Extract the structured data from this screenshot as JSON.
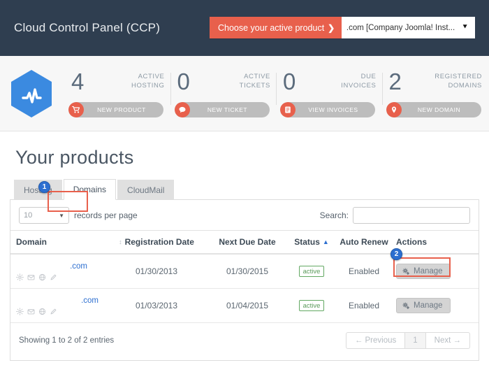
{
  "header": {
    "brand": "Cloud Control Panel (CCP)",
    "picker_label": "Choose your active product",
    "picker_chevron": "❯",
    "picker_value": ".com [Company Joomla! Inst...",
    "picker_caret": "⯆",
    "accent_color": "#e8604c",
    "bar_color": "#2f3e50"
  },
  "stats": {
    "logo_icon": "pulse-hexagon-logo",
    "items": [
      {
        "number": "4",
        "label_line1": "ACTIVE",
        "label_line2": "HOSTING",
        "button": "NEW PRODUCT",
        "icon": "shopping-cart-icon"
      },
      {
        "number": "0",
        "label_line1": "ACTIVE",
        "label_line2": "TICKETS",
        "button": "NEW TICKET",
        "icon": "speech-bubble-icon"
      },
      {
        "number": "0",
        "label_line1": "DUE",
        "label_line2": "INVOICES",
        "button": "VIEW INVOICES",
        "icon": "invoice-list-icon"
      },
      {
        "number": "2",
        "label_line1": "REGISTERED",
        "label_line2": "DOMAINS",
        "button": "NEW DOMAIN",
        "icon": "globe-shield-icon"
      }
    ]
  },
  "page": {
    "title": "Your products"
  },
  "tabs": [
    {
      "label": "Hosting",
      "active": false
    },
    {
      "label": "Domains",
      "active": true
    },
    {
      "label": "CloudMail",
      "active": false
    }
  ],
  "annotations": [
    {
      "number": "1",
      "target": "domains-tab"
    },
    {
      "number": "2",
      "target": "manage-button-row-1"
    }
  ],
  "controls": {
    "records_per_page_value": "10",
    "records_per_page_label": "records per page",
    "search_label": "Search:",
    "search_value": "",
    "search_placeholder": ""
  },
  "table": {
    "columns": [
      {
        "label": "Domain",
        "sort": "none"
      },
      {
        "label": "Registration Date",
        "sort": "both"
      },
      {
        "label": "Next Due Date",
        "sort": "none"
      },
      {
        "label": "Status",
        "sort": "asc"
      },
      {
        "label": "Auto Renew",
        "sort": "none"
      },
      {
        "label": "Actions",
        "sort": "none"
      }
    ],
    "rows": [
      {
        "domain": ".com",
        "registration_date": "01/30/2013",
        "next_due_date": "01/30/2015",
        "status": "active",
        "auto_renew": "Enabled",
        "action": "Manage"
      },
      {
        "domain": ".com",
        "registration_date": "01/03/2013",
        "next_due_date": "01/04/2015",
        "status": "active",
        "auto_renew": "Enabled",
        "action": "Manage"
      }
    ],
    "row_icons": [
      "gear-icon",
      "envelope-icon",
      "globe-icon",
      "pencil-icon"
    ]
  },
  "footer": {
    "entries_text": "Showing 1 to 2 of 2 entries",
    "previous": "← Previous",
    "page_current": "1",
    "next": "Next →"
  }
}
